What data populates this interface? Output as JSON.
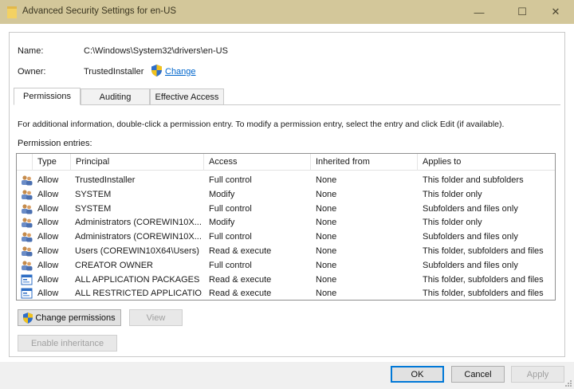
{
  "window": {
    "title": "Advanced Security Settings for en-US",
    "controls": {
      "minimize": "—",
      "maximize": "☐",
      "close": "✕"
    }
  },
  "object": {
    "name_label": "Name:",
    "name_value": "C:\\Windows\\System32\\drivers\\en-US",
    "owner_label": "Owner:",
    "owner_value": "TrustedInstaller",
    "change_link": "Change"
  },
  "tabs": [
    {
      "label": "Permissions",
      "active": true
    },
    {
      "label": "Auditing",
      "active": false
    },
    {
      "label": "Effective Access",
      "active": false
    }
  ],
  "info_text": "For additional information, double-click a permission entry. To modify a permission entry, select the entry and click Edit (if available).",
  "entries_label": "Permission entries:",
  "columns": [
    "Type",
    "Principal",
    "Access",
    "Inherited from",
    "Applies to"
  ],
  "entries": [
    {
      "icon": "users-icon",
      "type": "Allow",
      "principal": "TrustedInstaller",
      "access": "Full control",
      "inherited": "None",
      "applies": "This folder and subfolders"
    },
    {
      "icon": "users-icon",
      "type": "Allow",
      "principal": "SYSTEM",
      "access": "Modify",
      "inherited": "None",
      "applies": "This folder only"
    },
    {
      "icon": "users-icon",
      "type": "Allow",
      "principal": "SYSTEM",
      "access": "Full control",
      "inherited": "None",
      "applies": "Subfolders and files only"
    },
    {
      "icon": "users-icon",
      "type": "Allow",
      "principal": "Administrators (COREWIN10X...",
      "access": "Modify",
      "inherited": "None",
      "applies": "This folder only"
    },
    {
      "icon": "users-icon",
      "type": "Allow",
      "principal": "Administrators (COREWIN10X...",
      "access": "Full control",
      "inherited": "None",
      "applies": "Subfolders and files only"
    },
    {
      "icon": "users-icon",
      "type": "Allow",
      "principal": "Users (COREWIN10X64\\Users)",
      "access": "Read & execute",
      "inherited": "None",
      "applies": "This folder, subfolders and files"
    },
    {
      "icon": "users-icon",
      "type": "Allow",
      "principal": "CREATOR OWNER",
      "access": "Full control",
      "inherited": "None",
      "applies": "Subfolders and files only"
    },
    {
      "icon": "package-icon",
      "type": "Allow",
      "principal": "ALL APPLICATION PACKAGES",
      "access": "Read & execute",
      "inherited": "None",
      "applies": "This folder, subfolders and files"
    },
    {
      "icon": "package-icon",
      "type": "Allow",
      "principal": "ALL RESTRICTED APPLICATIO...",
      "access": "Read & execute",
      "inherited": "None",
      "applies": "This folder, subfolders and files"
    }
  ],
  "buttons": {
    "change_permissions": "Change permissions",
    "view": "View",
    "enable_inheritance": "Enable inheritance",
    "ok": "OK",
    "cancel": "Cancel",
    "apply": "Apply"
  },
  "colors": {
    "titlebar": "#d3c79a",
    "link": "#0066cc",
    "accent": "#0078d7"
  }
}
